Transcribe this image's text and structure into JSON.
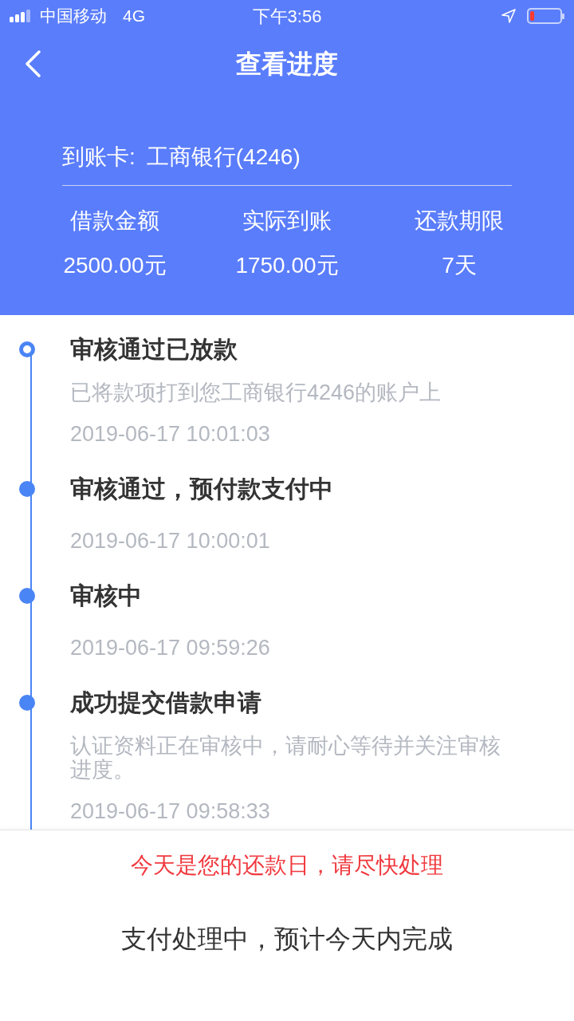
{
  "status_bar": {
    "carrier": "中国移动",
    "network": "4G",
    "time": "下午3:56"
  },
  "nav": {
    "title": "查看进度"
  },
  "card": {
    "label": "到账卡:",
    "value": "工商银行(4246)"
  },
  "summary": [
    {
      "label": "借款金额",
      "value": "2500.00元"
    },
    {
      "label": "实际到账",
      "value": "1750.00元"
    },
    {
      "label": "还款期限",
      "value": "7天"
    }
  ],
  "timeline": [
    {
      "title": "审核通过已放款",
      "description": "已将款项打到您工商银行4246的账户上",
      "time": "2019-06-17 10:01:03",
      "current": true
    },
    {
      "title": "审核通过，预付款支付中",
      "time": "2019-06-17 10:00:01",
      "current": false
    },
    {
      "title": "审核中",
      "time": "2019-06-17 09:59:26",
      "current": false
    },
    {
      "title": "成功提交借款申请",
      "description": "认证资料正在审核中，请耐心等待并关注审核进度。",
      "time": "2019-06-17 09:58:33",
      "current": false
    }
  ],
  "notice": "今天是您的还款日，请尽快处理",
  "status_message": "支付处理中，预计今天内完成"
}
